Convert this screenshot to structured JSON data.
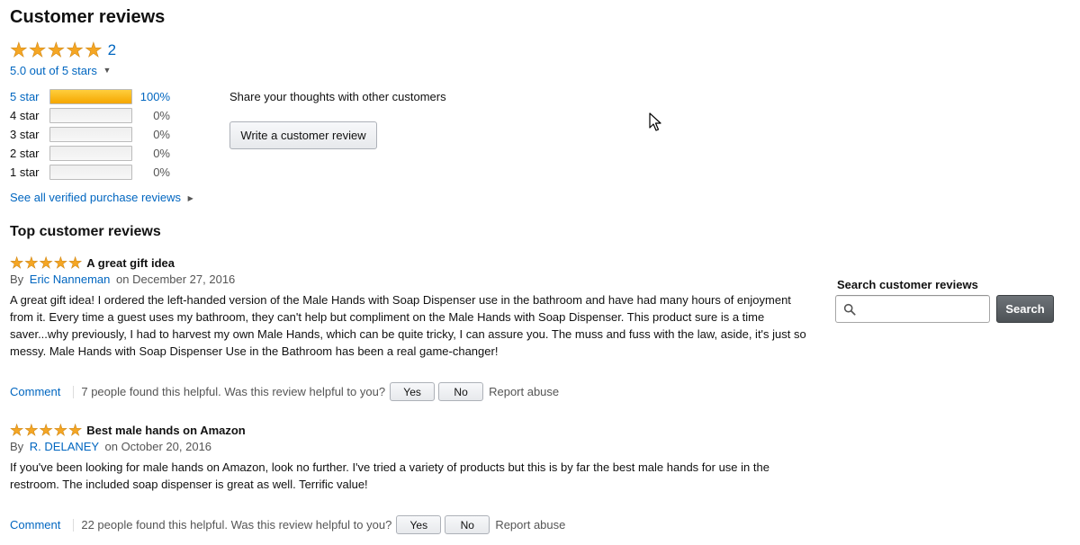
{
  "header": {
    "title": "Customer reviews"
  },
  "summary": {
    "rating": 5,
    "review_count": "2",
    "rating_text": "5.0 out of 5 stars",
    "histogram": [
      {
        "label": "5 star",
        "percent_text": "100%",
        "fraction": 1.0
      },
      {
        "label": "4 star",
        "percent_text": "0%",
        "fraction": 0
      },
      {
        "label": "3 star",
        "percent_text": "0%",
        "fraction": 0
      },
      {
        "label": "2 star",
        "percent_text": "0%",
        "fraction": 0
      },
      {
        "label": "1 star",
        "percent_text": "0%",
        "fraction": 0
      }
    ],
    "see_all_link": "See all verified purchase reviews",
    "share_text": "Share your thoughts with other customers",
    "write_review_button": "Write a customer review"
  },
  "top_reviews": {
    "title": "Top customer reviews",
    "items": [
      {
        "rating": 5,
        "title": "A great gift idea",
        "by_label": "By",
        "author": "Eric Nanneman",
        "date": "on December 27, 2016",
        "body": "A great gift idea! I ordered the left-handed version of the Male Hands with Soap Dispenser use in the bathroom and have had many hours of enjoyment from it. Every time a guest uses my bathroom, they can't help but compliment on the Male Hands with Soap Dispenser. This product sure is a time saver...why previously, I had to harvest my own Male Hands, which can be quite tricky, I can assure you. The muss and fuss with the law, aside, it's just so messy. Male Hands with Soap Dispenser Use in the Bathroom has been a real game-changer!",
        "comment_label": "Comment",
        "helpful_text": "7 people found this helpful. Was this review helpful to you?",
        "yes_label": "Yes",
        "no_label": "No",
        "report_label": "Report abuse"
      },
      {
        "rating": 5,
        "title": "Best male hands on Amazon",
        "by_label": "By",
        "author": "R. DELANEY",
        "date": "on October 20, 2016",
        "body": "If you've been looking for male hands on Amazon, look no further. I've tried a variety of products but this is by far the best male hands for use in the restroom. The included soap dispenser is great as well. Terrific value!",
        "comment_label": "Comment",
        "helpful_text": "22 people found this helpful. Was this review helpful to you?",
        "yes_label": "Yes",
        "no_label": "No",
        "report_label": "Report abuse"
      }
    ]
  },
  "search": {
    "label": "Search customer reviews",
    "placeholder": "",
    "button_label": "Search"
  },
  "icons": {
    "star": "star-icon",
    "search": "magnifier-icon",
    "caret": "caret-down-icon",
    "chevron": "chevron-right-icon",
    "cursor": "mouse-cursor-icon"
  },
  "colors": {
    "link": "#0066c0",
    "star": "#f5a623",
    "search_button": "#4d5256"
  }
}
